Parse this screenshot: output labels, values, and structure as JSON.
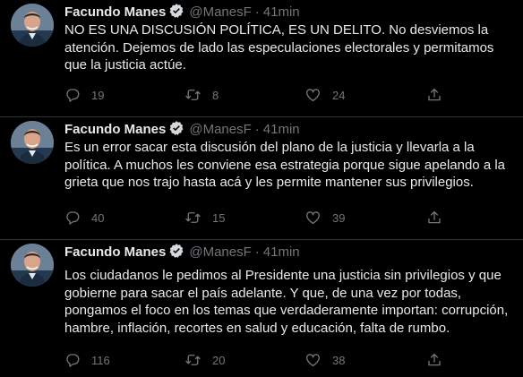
{
  "author": {
    "name": "Facundo Manes",
    "handle": "@ManesF",
    "dot": "·"
  },
  "colors": {
    "background": "#000000",
    "text": "#e7e9ea",
    "muted": "#71767b",
    "divider": "#2f3336",
    "verified": "#1d9bf0"
  },
  "icons": {
    "verified": "verified-badge-icon",
    "reply": "reply-icon",
    "retweet": "retweet-icon",
    "like": "heart-icon",
    "share": "share-icon"
  },
  "tweets": [
    {
      "time": "41min",
      "text": "NO ES UNA DISCUSIÓN POLÍTICA, ES UN DELITO. No desviemos la\natención. Dejemos de lado las especulaciones electorales y permitamos\nque la justicia actúe.",
      "replies": "19",
      "retweets": "8",
      "likes": "24"
    },
    {
      "time": "41min",
      "text": "Es un error sacar esta discusión del plano de la justicia y llevarla a la\npolítica. A muchos les conviene esa estrategia porque sigue apelando a la\ngrieta que nos trajo hasta acá y les permite mantener sus privilegios.",
      "replies": "40",
      "retweets": "15",
      "likes": "39"
    },
    {
      "time": "41min",
      "text": "Los ciudadanos le pedimos al Presidente una justicia sin privilegios y que\ngobierne para sacar el país adelante. Y que, de una vez por todas,\npongamos el foco en los temas que verdaderamente importan: corrupción,\nhambre, inflación, recortes en salud y educación, falta de rumbo.",
      "replies": "116",
      "retweets": "20",
      "likes": "38"
    }
  ]
}
